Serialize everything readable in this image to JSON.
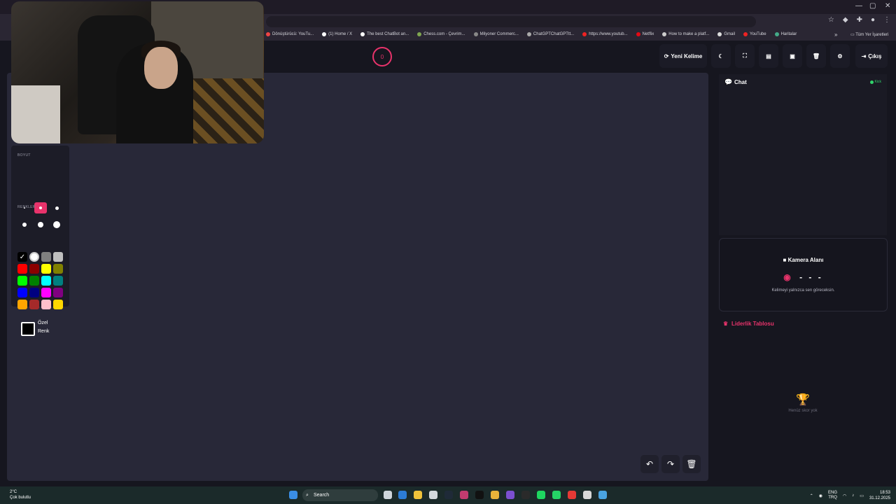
{
  "browser": {
    "bookmarks": [
      {
        "label": "Dönüştürücü: YouTu...",
        "color": "#e44"
      },
      {
        "label": "(1) Home / X",
        "color": "#fff"
      },
      {
        "label": "The best ChatBot an...",
        "color": "#fff"
      },
      {
        "label": "Chess.com - Çevrim...",
        "color": "#7fa650"
      },
      {
        "label": "Milyoner Commerc...",
        "color": "#888"
      },
      {
        "label": "ChatGPTChatGPTtt...",
        "color": "#aaa"
      },
      {
        "label": "https://www.youtub...",
        "color": "#e22"
      },
      {
        "label": "Netflix",
        "color": "#e50914"
      },
      {
        "label": "How to make a platf...",
        "color": "#ccc"
      },
      {
        "label": "Gmail",
        "color": "#ddd"
      },
      {
        "label": "YouTube",
        "color": "#e22"
      },
      {
        "label": "Haritalar",
        "color": "#4a8"
      }
    ],
    "all_bookmarks": "Tüm Yer İşaretleri",
    "more": "»"
  },
  "header": {
    "timer": "0",
    "new_word": "Yeni Kelime",
    "logout": "Çıkış"
  },
  "tools": {
    "size_label": "BOYUT",
    "colors_label": "RENKLER",
    "custom_color_line1": "Özel",
    "custom_color_line2": "Renk",
    "sizes": [
      2,
      4,
      5,
      6,
      8,
      10
    ],
    "selected_size_index": 1,
    "palette": [
      "#000000",
      "#ffffff",
      "#808080",
      "#bfbfbf",
      "#ff0000",
      "#8b0000",
      "#ffff00",
      "#808000",
      "#00ff00",
      "#008000",
      "#00ffff",
      "#008080",
      "#0000ff",
      "#000080",
      "#ff00ff",
      "#800080",
      "#ffa500",
      "#a52a2a",
      "#ffc0cb",
      "#ffd700"
    ]
  },
  "chat": {
    "title": "Chat",
    "status": "Kick",
    "status_color": "#31d36b"
  },
  "camera": {
    "title": "Kamera Alanı",
    "word": "- - -",
    "note": "Kelimeyi yalnızca sen göreceksin."
  },
  "leaderboard": {
    "title": "Liderlik Tablosu",
    "empty": "Henüz skor yok"
  },
  "taskbar": {
    "temp": "2°C",
    "weather": "Çok bulutlu",
    "search": "Search",
    "lang1": "ENG",
    "lang2": "TRQ",
    "time": "18:53",
    "date": "31.12.2025"
  },
  "colors": {
    "accent": "#e8336b",
    "canvas": "#282838"
  }
}
